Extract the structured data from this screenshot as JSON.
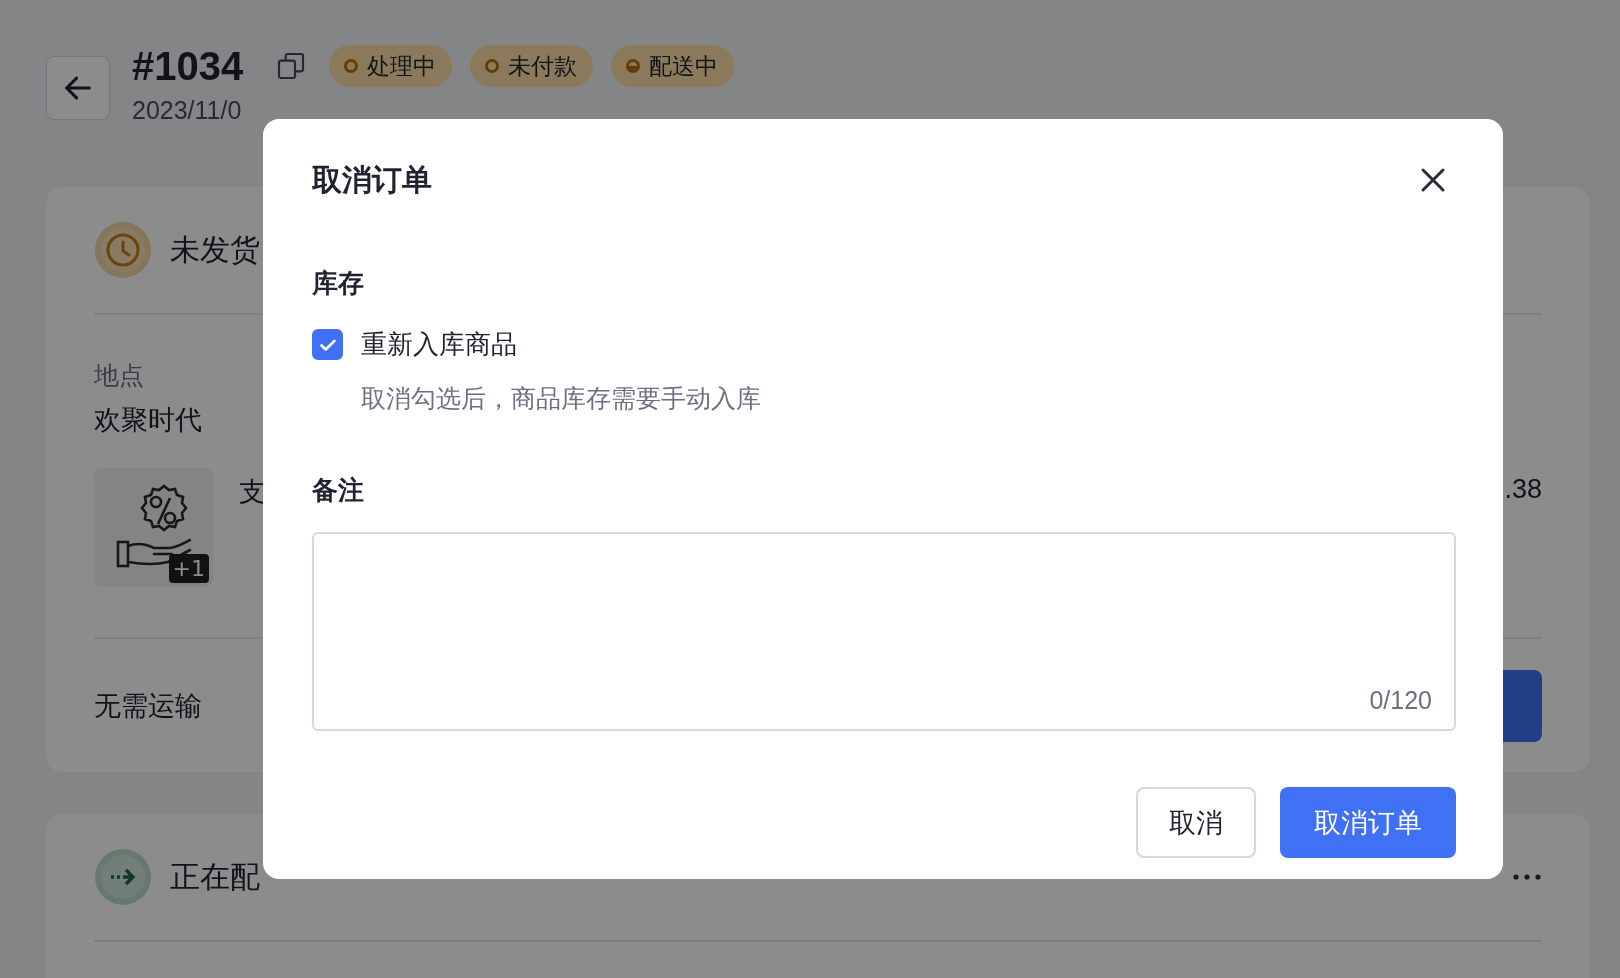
{
  "header": {
    "order_number": "#1034",
    "statuses": [
      {
        "label": "处理中",
        "kind": "ring"
      },
      {
        "label": "未付款",
        "kind": "ring"
      },
      {
        "label": "配送中",
        "kind": "half"
      }
    ],
    "subtitle": "2023/11/0"
  },
  "fulfillment_card": {
    "title": "未发货",
    "location_label": "地点",
    "location": "欢聚时代",
    "image_badge": "+1",
    "item_text": "支",
    "amount": ".38",
    "footer": "无需运输"
  },
  "shipment_card": {
    "title": "正在配"
  },
  "dialog": {
    "title": "取消订单",
    "inventory_heading": "库存",
    "restock": {
      "label": "重新入库商品",
      "hint": "取消勾选后，商品库存需要手动入库",
      "checked": true
    },
    "note": {
      "heading": "备注",
      "counter": "0/120"
    },
    "buttons": [
      {
        "label": "取消",
        "kind": "secondary"
      },
      {
        "label": "取消订单",
        "kind": "primary"
      }
    ]
  }
}
